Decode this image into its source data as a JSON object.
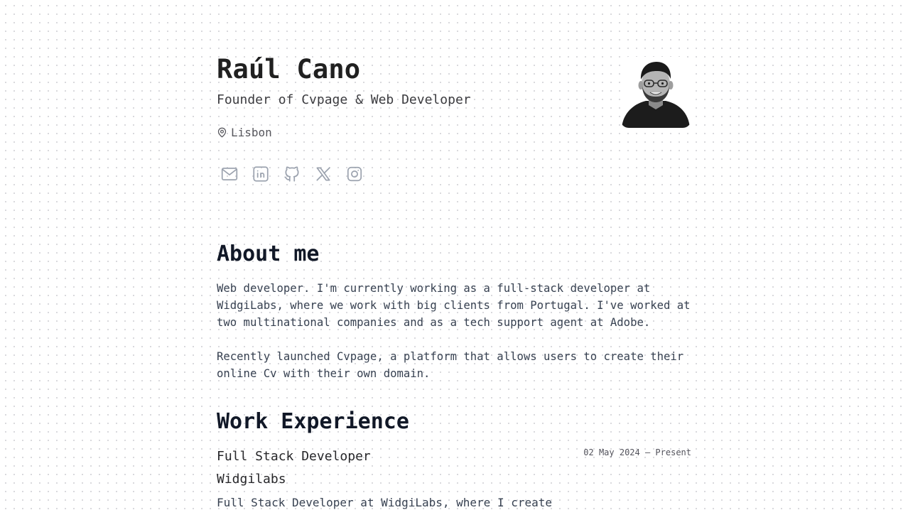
{
  "profile": {
    "name": "Raúl Cano",
    "tagline": "Founder of Cvpage & Web Developer",
    "location": "Lisbon"
  },
  "socials": [
    {
      "name": "email",
      "icon": "mail-icon"
    },
    {
      "name": "linkedin",
      "icon": "linkedin-icon"
    },
    {
      "name": "github",
      "icon": "github-icon"
    },
    {
      "name": "x",
      "icon": "x-icon"
    },
    {
      "name": "instagram",
      "icon": "instagram-icon"
    }
  ],
  "about": {
    "title": "About me",
    "paragraph1": "Web developer. I'm currently working as a full-stack developer at WidgiLabs, where we work with big clients from Portugal. I've worked at two multinational companies and as a tech support agent at Adobe.",
    "paragraph2": "Recently launched Cvpage, a platform that allows users to create their online Cv with their own domain."
  },
  "work": {
    "title": "Work Experience",
    "jobs": [
      {
        "title": "Full Stack Developer",
        "date": "02 May 2024 – Present",
        "company": "Widgilabs",
        "description": "Full Stack Developer at WidgiLabs, where I create"
      }
    ]
  },
  "colors": {
    "heading": "#111827",
    "text": "#374151",
    "icon": "#9ca3af"
  }
}
